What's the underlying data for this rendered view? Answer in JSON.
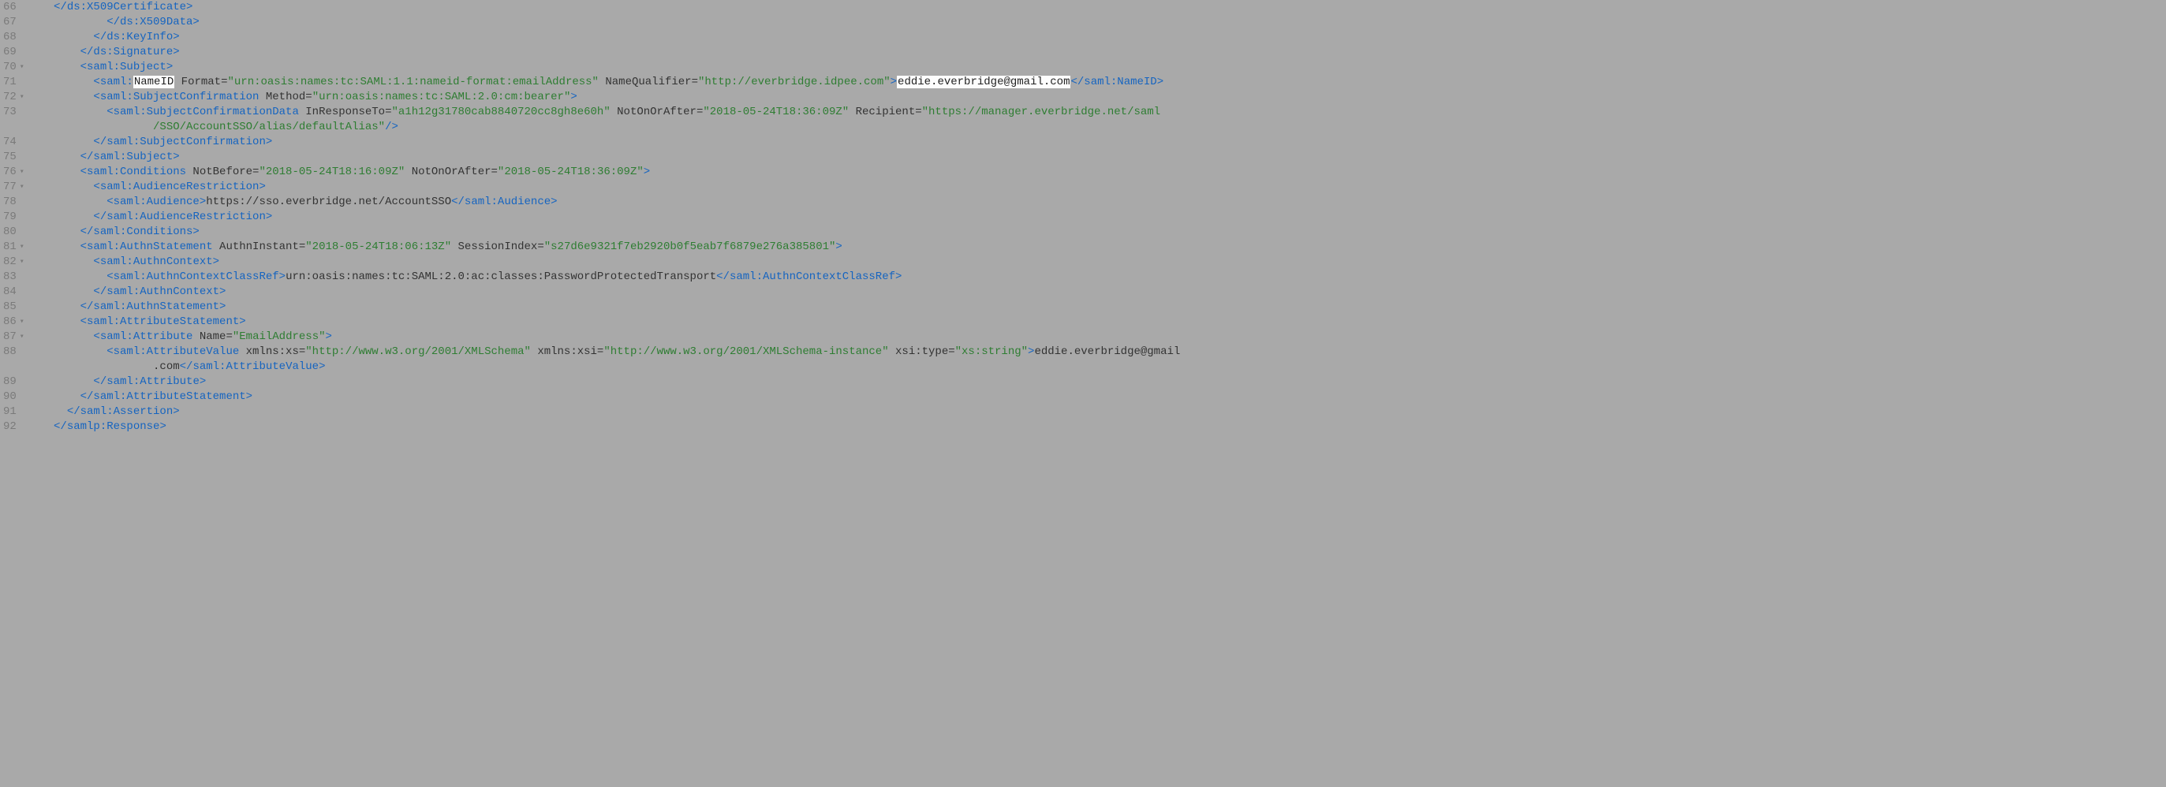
{
  "lines": [
    {
      "num": "66",
      "fold": ""
    },
    {
      "num": "67",
      "fold": ""
    },
    {
      "num": "68",
      "fold": ""
    },
    {
      "num": "69",
      "fold": ""
    },
    {
      "num": "70",
      "fold": "▾"
    },
    {
      "num": "71",
      "fold": ""
    },
    {
      "num": "72",
      "fold": "▾"
    },
    {
      "num": "73",
      "fold": ""
    },
    {
      "num": "74",
      "fold": ""
    },
    {
      "num": "75",
      "fold": ""
    },
    {
      "num": "76",
      "fold": "▾"
    },
    {
      "num": "77",
      "fold": "▾"
    },
    {
      "num": "78",
      "fold": ""
    },
    {
      "num": "79",
      "fold": ""
    },
    {
      "num": "80",
      "fold": ""
    },
    {
      "num": "81",
      "fold": "▾"
    },
    {
      "num": "82",
      "fold": "▾"
    },
    {
      "num": "83",
      "fold": ""
    },
    {
      "num": "84",
      "fold": ""
    },
    {
      "num": "85",
      "fold": ""
    },
    {
      "num": "86",
      "fold": "▾"
    },
    {
      "num": "87",
      "fold": "▾"
    },
    {
      "num": "88",
      "fold": ""
    },
    {
      "num": "89",
      "fold": ""
    },
    {
      "num": "90",
      "fold": ""
    },
    {
      "num": "91",
      "fold": ""
    },
    {
      "num": "92",
      "fold": ""
    }
  ],
  "t": {
    "x509cert_close": "</ds:X509Certificate>",
    "x509data_close": "</ds:X509Data>",
    "keyinfo_close": "</ds:KeyInfo>",
    "signature_close": "</ds:Signature>",
    "subject_open": "<saml:Subject>",
    "nameid_open_pre": "<saml:",
    "nameid_hl": "NameID",
    "format_attr": " Format=",
    "format_val": "\"urn:oasis:names:tc:SAML:1.1:nameid-format:emailAddress\"",
    "namequal_attr": " NameQualifier=",
    "namequal_val": "\"http://everbridge.idpee.com\"",
    "gt": ">",
    "email_hl": "eddie.everbridge@gmail.com",
    "nameid_close": "</saml:NameID>",
    "subjconf_open": "<saml:SubjectConfirmation",
    "method_attr": " Method=",
    "method_val": "\"urn:oasis:names:tc:SAML:2.0:cm:bearer\"",
    "subjconfdata_open": "<saml:SubjectConfirmationData",
    "inresp_attr": " InResponseTo=",
    "inresp_val": "\"a1h12g31780cab8840720cc8gh8e60h\"",
    "noa_attr": " NotOnOrAfter=",
    "noa_val": "\"2018-05-24T18:36:09Z\"",
    "recip_attr": " Recipient=",
    "recip_val": "\"https://manager.everbridge.net/saml",
    "recip_val2": "/SSO/AccountSSO/alias/defaultAlias\"",
    "selfclose": "/>",
    "subjconf_close": "</saml:SubjectConfirmation>",
    "subject_close": "</saml:Subject>",
    "cond_open": "<saml:Conditions",
    "notbefore_attr": " NotBefore=",
    "notbefore_val": "\"2018-05-24T18:16:09Z\"",
    "cond_noa_val": "\"2018-05-24T18:36:09Z\"",
    "audrest_open": "<saml:AudienceRestriction>",
    "aud_open": "<saml:Audience>",
    "aud_text": "https://sso.everbridge.net/AccountSSO",
    "aud_close": "</saml:Audience>",
    "audrest_close": "</saml:AudienceRestriction>",
    "cond_close": "</saml:Conditions>",
    "authnstmt_open": "<saml:AuthnStatement",
    "authninst_attr": " AuthnInstant=",
    "authninst_val": "\"2018-05-24T18:06:13Z\"",
    "sessidx_attr": " SessionIndex=",
    "sessidx_val": "\"s27d6e9321f7eb2920b0f5eab7f6879e276a385801\"",
    "authnctx_open": "<saml:AuthnContext>",
    "authnctxref_open": "<saml:AuthnContextClassRef>",
    "authnctxref_text": "urn:oasis:names:tc:SAML:2.0:ac:classes:PasswordProtectedTransport",
    "authnctxref_close": "</saml:AuthnContextClassRef>",
    "authnctx_close": "</saml:AuthnContext>",
    "authnstmt_close": "</saml:AuthnStatement>",
    "attrstmt_open": "<saml:AttributeStatement>",
    "attr_open": "<saml:Attribute",
    "attr_name_attr": " Name=",
    "attr_name_val": "\"EmailAddress\"",
    "attrval_open": "<saml:AttributeValue",
    "xs_attr": " xmlns:xs=",
    "xs_val": "\"http://www.w3.org/2001/XMLSchema\"",
    "xsi_attr": " xmlns:xsi=",
    "xsi_val": "\"http://www.w3.org/2001/XMLSchema-instance\"",
    "xsitype_attr": " xsi:type=",
    "xsitype_val": "\"xs:string\"",
    "attrval_text1": "eddie.everbridge@gmail",
    "attrval_text2": ".com",
    "attrval_close": "</saml:AttributeValue>",
    "attr_close": "</saml:Attribute>",
    "attrstmt_close": "</saml:AttributeStatement>",
    "assertion_close": "</saml:Assertion>",
    "response_close": "</samlp:Response>"
  }
}
